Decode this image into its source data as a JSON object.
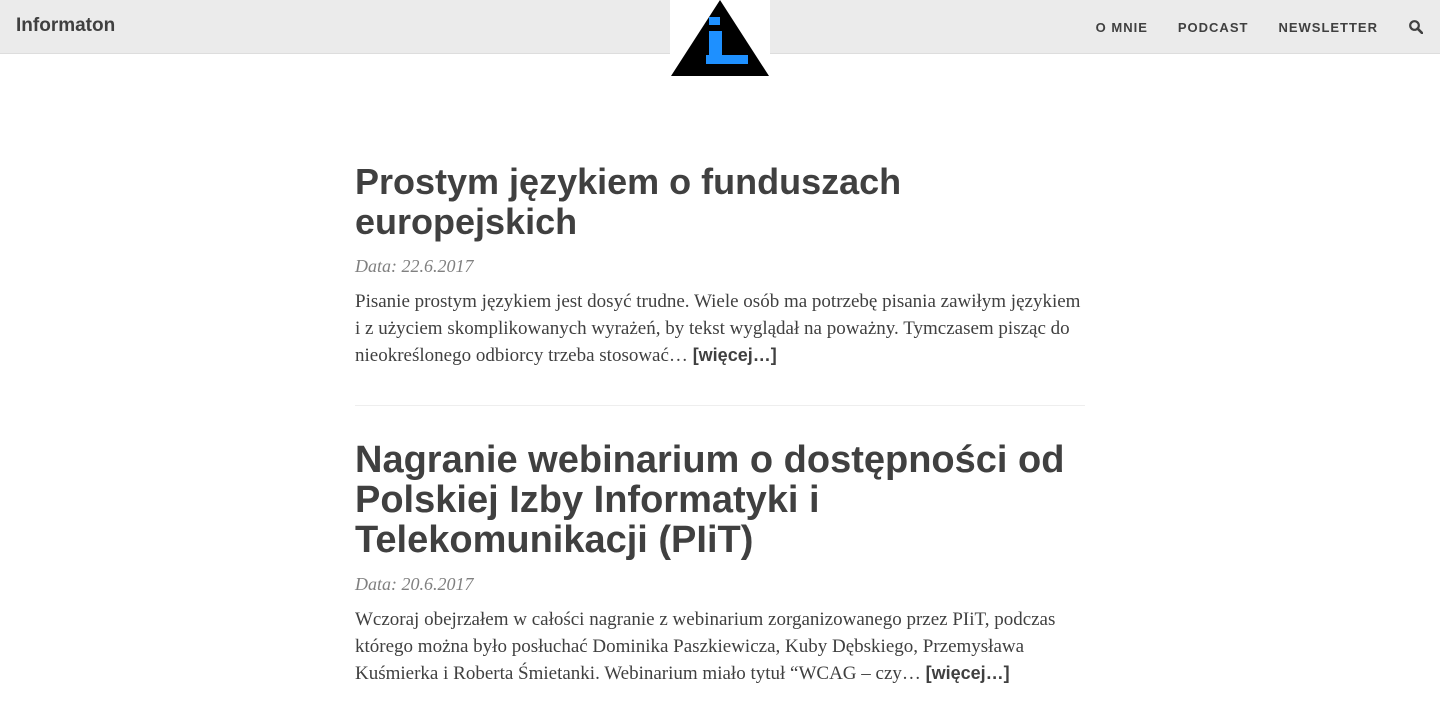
{
  "navbar": {
    "brand": "Informaton",
    "links": [
      "O MNIE",
      "PODCAST",
      "NEWSLETTER"
    ],
    "search_icon": "search-icon",
    "logo_icon": "info-triangle-logo"
  },
  "posts": [
    {
      "title": "Prostym językiem o funduszach europejskich",
      "meta": "Data: 22.6.2017",
      "excerpt": "Pisanie prostym językiem jest dosyć trudne. Wiele osób ma potrzebę pisania zawiłym językiem i z użyciem skomplikowanych wyrażeń, by tekst wyglądał na poważny. Tymczasem pisząc do nieokreślonego odbiorcy trzeba stosować…",
      "more": "[więcej…]"
    },
    {
      "title": "Nagranie webinarium o dostępności od Polskiej Izby Informatyki i Telekomunikacji (PIiT)",
      "meta": "Data: 20.6.2017",
      "excerpt": "Wczoraj obejrzałem w całości nagranie z webinarium zorganizowanego przez PIiT, podczas którego można było posłuchać Dominika Paszkiewicza, Kuby Dębskiego, Przemysława Kuśmierka i Roberta Śmietanki. Webinarium miało tytuł “WCAG – czy…",
      "more": "[więcej…]"
    }
  ],
  "colors": {
    "navbar_bg": "#ebebeb",
    "text": "#404040",
    "meta": "#808080",
    "logo_accent": "#1e90ff"
  }
}
